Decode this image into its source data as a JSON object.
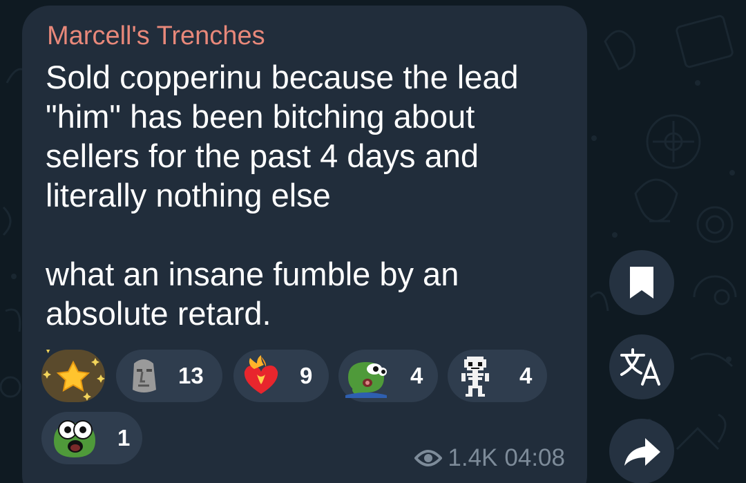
{
  "message": {
    "sender": "Marcell's Trenches",
    "lines": [
      "Sold copperinu because the lead",
      "\"him\" has been bitching about",
      "sellers for the past 4 days and",
      "literally nothing else",
      "what an insane fumble by an",
      "absolute retard."
    ]
  },
  "reactions": [
    {
      "icon": "star-icon",
      "count": ""
    },
    {
      "icon": "moai-icon",
      "count": "13"
    },
    {
      "icon": "heart-on-fire-icon",
      "count": "9"
    },
    {
      "icon": "pepe-donut-icon",
      "count": "4"
    },
    {
      "icon": "skeleton-icon",
      "count": "4"
    },
    {
      "icon": "pepe-shocked-icon",
      "count": "1"
    }
  ],
  "meta": {
    "views": "1.4K",
    "time": "04:08"
  },
  "actions": [
    {
      "icon": "bookmark-icon"
    },
    {
      "icon": "translate-icon"
    },
    {
      "icon": "share-icon"
    }
  ],
  "colors": {
    "background": "#0f1a22",
    "bubble": "#212d3b",
    "sender": "#e8887a",
    "text": "#ffffff",
    "meta": "#7d8b99",
    "reaction_bg": "#2f3d4e"
  }
}
